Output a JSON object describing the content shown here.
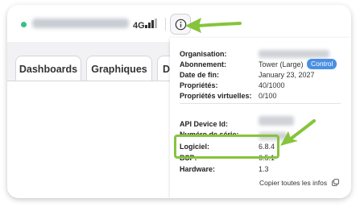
{
  "topbar": {
    "signal_label": "4G",
    "info_button_icon": "info-circle-icon"
  },
  "tabs": [
    {
      "label": "Dashboards"
    },
    {
      "label": "Graphiques"
    },
    {
      "label": "Don"
    }
  ],
  "info_panel": {
    "organisation_label": "Organisation:",
    "subscription_label": "Abonnement:",
    "subscription_value": "Tower (Large)",
    "subscription_badge": "Control",
    "end_date_label": "Date de fin:",
    "end_date_value": "January 23, 2027",
    "properties_label": "Propriétés:",
    "properties_value": "40/1000",
    "virtual_properties_label": "Propriétés virtuelles:",
    "virtual_properties_value": "0/100",
    "api_device_id_label": "API Device Id:",
    "serial_label": "Numéro de série:",
    "software_label": "Logiciel:",
    "software_value": "6.8.4",
    "bsp_label": "BSP:",
    "bsp_value": "6.5.1",
    "hardware_label": "Hardware:",
    "hardware_value": "1.3",
    "copy_all_label": "Copier toutes les infos",
    "copy_icon": "copy-icon"
  },
  "colors": {
    "status_online": "#37c08a",
    "badge": "#4a90e2",
    "highlight": "#86c43c"
  }
}
